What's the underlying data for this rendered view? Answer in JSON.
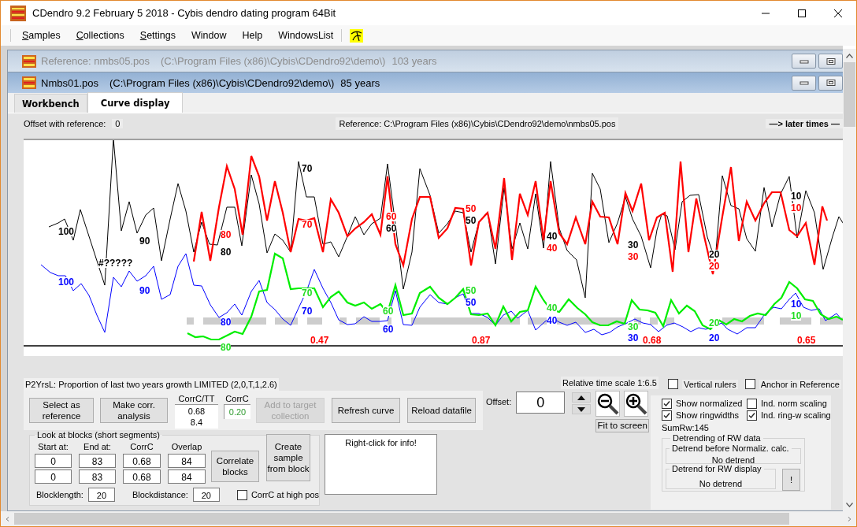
{
  "window": {
    "title": "CDendro 9.2  February 5 2018 - Cybis dendro dating program  64Bit"
  },
  "menu": [
    {
      "label": "Samples",
      "underline_first": true
    },
    {
      "label": "Collections",
      "underline_first": true
    },
    {
      "label": "Settings",
      "underline_first": true
    },
    {
      "label": "Window",
      "underline_first": false
    },
    {
      "label": "Help",
      "underline_first": false
    },
    {
      "label": "WindowsList",
      "underline_first": false
    }
  ],
  "reference_window": {
    "name": "Reference: nmbs05.pos",
    "path": "(C:\\Program Files (x86)\\Cybis\\CDendro92\\demo\\)",
    "years": "103 years"
  },
  "sample_window": {
    "name": "Nmbs01.pos",
    "path": "(C:\\Program Files (x86)\\Cybis\\CDendro92\\demo\\)",
    "years": "85 years"
  },
  "tabs": [
    {
      "label": "Workbench",
      "selected": false
    },
    {
      "label": "Curve display",
      "selected": true
    }
  ],
  "info_bar": {
    "offset_label": "Offset with reference:",
    "offset_value": "0",
    "reference": "Reference: C:\\Program Files (x86)\\Cybis\\CDendro92\\demo\\nmbs05.pos",
    "direction": "—> later times —"
  },
  "curve_labels": [
    {
      "text": "100",
      "color": "#000000"
    },
    {
      "text": "90",
      "color": "#000000"
    },
    {
      "text": "80",
      "color": "#000000"
    },
    {
      "text": "#?????",
      "color": "#000000"
    },
    {
      "text": "70",
      "color": "#000000"
    },
    {
      "text": "60",
      "color": "#000000"
    },
    {
      "text": "50",
      "color": "#000000"
    },
    {
      "text": "40",
      "color": "#000000"
    },
    {
      "text": "30",
      "color": "#000000"
    },
    {
      "text": "20",
      "color": "#000000"
    },
    {
      "text": "10",
      "color": "#000000"
    },
    {
      "text": "80",
      "color": "#ff0000"
    },
    {
      "text": "70",
      "color": "#ff0000"
    },
    {
      "text": "60",
      "color": "#ff0000"
    },
    {
      "text": "50",
      "color": "#ff0000"
    },
    {
      "text": "40",
      "color": "#ff0000"
    },
    {
      "text": "30",
      "color": "#ff0000"
    },
    {
      "text": "20",
      "color": "#ff0000"
    },
    {
      "text": "10",
      "color": "#ff0000"
    },
    {
      "text": "100",
      "color": "#0000ff"
    },
    {
      "text": "90",
      "color": "#0000ff"
    },
    {
      "text": "80",
      "color": "#0000ff"
    },
    {
      "text": "70",
      "color": "#0000ff"
    },
    {
      "text": "60",
      "color": "#0000ff"
    },
    {
      "text": "50",
      "color": "#0000ff"
    },
    {
      "text": "40",
      "color": "#0000ff"
    },
    {
      "text": "30",
      "color": "#0000ff"
    },
    {
      "text": "20",
      "color": "#0000ff"
    },
    {
      "text": "10",
      "color": "#0000ff"
    },
    {
      "text": "80",
      "color": "#22dd22"
    },
    {
      "text": "70",
      "color": "#22dd22"
    },
    {
      "text": "60",
      "color": "#22dd22"
    },
    {
      "text": "50",
      "color": "#22dd22"
    },
    {
      "text": "40",
      "color": "#22dd22"
    },
    {
      "text": "30",
      "color": "#22dd22"
    },
    {
      "text": "20",
      "color": "#22dd22"
    },
    {
      "text": "10",
      "color": "#22dd22"
    },
    {
      "text": "0.47",
      "color": "#ff0000"
    },
    {
      "text": "0.87",
      "color": "#ff0000"
    },
    {
      "text": "0.68",
      "color": "#ff0000"
    },
    {
      "text": "0.65",
      "color": "#ff0000"
    }
  ],
  "status_line": "P2YrsL: Proportion of last two years growth LIMITED (2,0,T,1,2.6)",
  "left_buttons": [
    {
      "label": "Select as reference",
      "disabled": false
    },
    {
      "label": "Make corr. analysis",
      "disabled": false
    }
  ],
  "corrc_tt": {
    "label": "CorrC/TT",
    "values": [
      "0.68",
      "8.4"
    ]
  },
  "corrc": {
    "label": "CorrC",
    "value": "0.20"
  },
  "right_buttons": [
    {
      "label": "Add to target collection",
      "disabled": true
    },
    {
      "label": "Refresh curve",
      "disabled": false
    },
    {
      "label": "Reload datafile",
      "disabled": false
    }
  ],
  "blocks": {
    "title": "Look at blocks (short segments)",
    "columns": [
      "Start at:",
      "End at:",
      "CorrC",
      "Overlap"
    ],
    "rows": [
      [
        "0",
        "83",
        "0.68",
        "84"
      ],
      [
        "0",
        "83",
        "0.68",
        "84"
      ]
    ],
    "correlate_button": "Correlate blocks",
    "create_button": "Create sample from block",
    "blocklength_label": "Blocklength:",
    "blocklength": "20",
    "blockdistance_label": "Blockdistance:",
    "blockdistance": "20",
    "high_pos": {
      "label": "CorrC at high pos",
      "checked": false
    }
  },
  "info_box": "Right-click for info!",
  "time_scale": "Relative time scale 1:6.5",
  "offset": {
    "label": "Offset:",
    "value": "0"
  },
  "fit_button": "Fit to screen",
  "top_checks": [
    {
      "label": "Vertical rulers",
      "checked": false
    },
    {
      "label": "Anchor in Reference",
      "checked": false
    }
  ],
  "display_checks": [
    {
      "label": "Show normalized",
      "checked": true
    },
    {
      "label": "Ind. norm scaling",
      "checked": false
    },
    {
      "label": "Show ringwidths",
      "checked": true
    },
    {
      "label": "Ind. ring-w scaling",
      "checked": true
    }
  ],
  "sum_rw": "SumRw:145",
  "detrending": {
    "title": "Detrending of RW data",
    "before": {
      "title": "Detrend before Normaliz. calc.",
      "value": "No detrend"
    },
    "display": {
      "title": "Detrend for RW display",
      "value": "No detrend"
    },
    "button": "!"
  }
}
